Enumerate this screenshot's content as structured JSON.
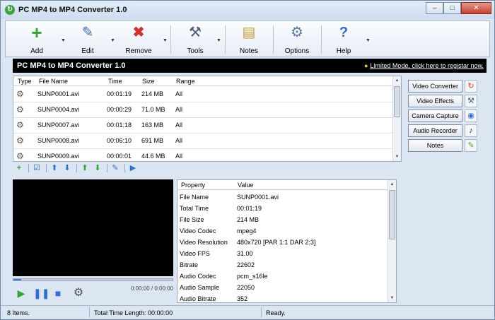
{
  "window": {
    "title": "PC MP4 to MP4 Converter 1.0",
    "controls": {
      "minimize": "–",
      "maximize": "□",
      "close": "✕"
    }
  },
  "toolbar": {
    "add_label": "Add",
    "edit_label": "Edit",
    "remove_label": "Remove",
    "tools_label": "Tools",
    "notes_label": "Notes",
    "options_label": "Options",
    "help_label": "Help"
  },
  "banner": {
    "title": "PC MP4 to MP4 Converter 1.0",
    "link": "Limited Mode, click here to registar now."
  },
  "filelist": {
    "columns": [
      "Type",
      "File Name",
      "Time",
      "Size",
      "Range"
    ],
    "rows": [
      {
        "name": "SUNP0001.avi",
        "time": "00:01:19",
        "size": "214 MB",
        "range": "All"
      },
      {
        "name": "SUNP0004.avi",
        "time": "00:00:29",
        "size": "71.0 MB",
        "range": "All"
      },
      {
        "name": "SUNP0007.avi",
        "time": "00:01:18",
        "size": "163 MB",
        "range": "All"
      },
      {
        "name": "SUNP0008.avi",
        "time": "00:06:10",
        "size": "691 MB",
        "range": "All"
      },
      {
        "name": "SUNP0009.avi",
        "time": "00:00:01",
        "size": "44.6 MB",
        "range": "All"
      }
    ]
  },
  "player": {
    "timecode": "0:00:00 / 0:00:00",
    "progress": 0.05
  },
  "properties": {
    "columns": [
      "Property",
      "Value"
    ],
    "rows": [
      {
        "key": "File Name",
        "value": "SUNP0001.avi"
      },
      {
        "key": "Total Time",
        "value": "00:01:19"
      },
      {
        "key": "File Size",
        "value": "214 MB"
      },
      {
        "key": "Video Codec",
        "value": "mpeg4"
      },
      {
        "key": "Video Resolution",
        "value": "480x720 [PAR 1:1 DAR 2:3]"
      },
      {
        "key": "Video FPS",
        "value": "31.00"
      },
      {
        "key": "Bitrate",
        "value": "22602"
      },
      {
        "key": "Audio Codec",
        "value": "pcm_s16le"
      },
      {
        "key": "Audio Sample",
        "value": "22050"
      },
      {
        "key": "Audio Bitrate",
        "value": "352"
      }
    ]
  },
  "side": {
    "video_converter": "Video Converter",
    "video_effects": "Video Effects",
    "camera_capture": "Camera Capture",
    "audio_recorder": "Audio Recorder",
    "notes": "Notes"
  },
  "status": {
    "items": "8 Items.",
    "total_time": "Total Time Length: 00:00:00",
    "state": "Ready."
  }
}
